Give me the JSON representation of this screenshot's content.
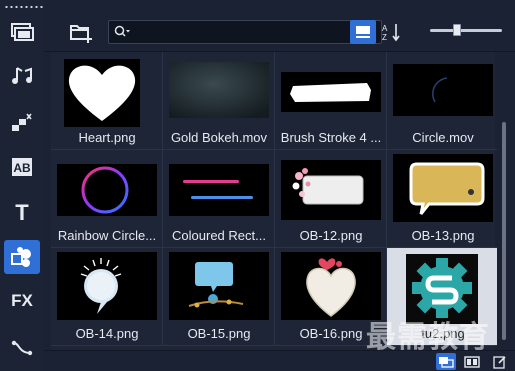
{
  "toolbar": {
    "search": {
      "value": "",
      "placeholder": ""
    },
    "clear_label": "×",
    "view_button": "list-view-icon",
    "sort_button": "sort-az-icon",
    "thumb_size_level": 0.36
  },
  "rail": {
    "items": [
      {
        "icon": "media-icon"
      },
      {
        "icon": "audio-icon"
      },
      {
        "icon": "transition-icon"
      },
      {
        "icon": "title-ab-icon",
        "label": "AB"
      },
      {
        "icon": "text-icon",
        "label": "T"
      },
      {
        "icon": "graphics-icon",
        "active": true
      },
      {
        "icon": "fx-icon",
        "label": "FX"
      },
      {
        "icon": "path-icon"
      }
    ]
  },
  "library": {
    "items": [
      {
        "name": "Heart.png",
        "kind": "heart"
      },
      {
        "name": "Gold Bokeh.mov",
        "kind": "bokeh"
      },
      {
        "name": "Brush Stroke 4 ...",
        "kind": "brush"
      },
      {
        "name": "Circle.mov",
        "kind": "circlemov"
      },
      {
        "name": "Rainbow Circle...",
        "kind": "rainbow"
      },
      {
        "name": "Coloured Rect...",
        "kind": "rects"
      },
      {
        "name": "OB-12.png",
        "kind": "ob12"
      },
      {
        "name": "OB-13.png",
        "kind": "ob13"
      },
      {
        "name": "OB-14.png",
        "kind": "ob14"
      },
      {
        "name": "OB-15.png",
        "kind": "ob15"
      },
      {
        "name": "OB-16.png",
        "kind": "ob16"
      },
      {
        "name": "tu2.png",
        "kind": "logo",
        "selected": true
      }
    ]
  },
  "bottombar": {
    "buttons": [
      "library-view-icon",
      "panel-view-icon",
      "edit-icon"
    ]
  },
  "watermark": "最需教育",
  "colors": {
    "accent": "#2f6fd6",
    "background": "#1a2233"
  }
}
